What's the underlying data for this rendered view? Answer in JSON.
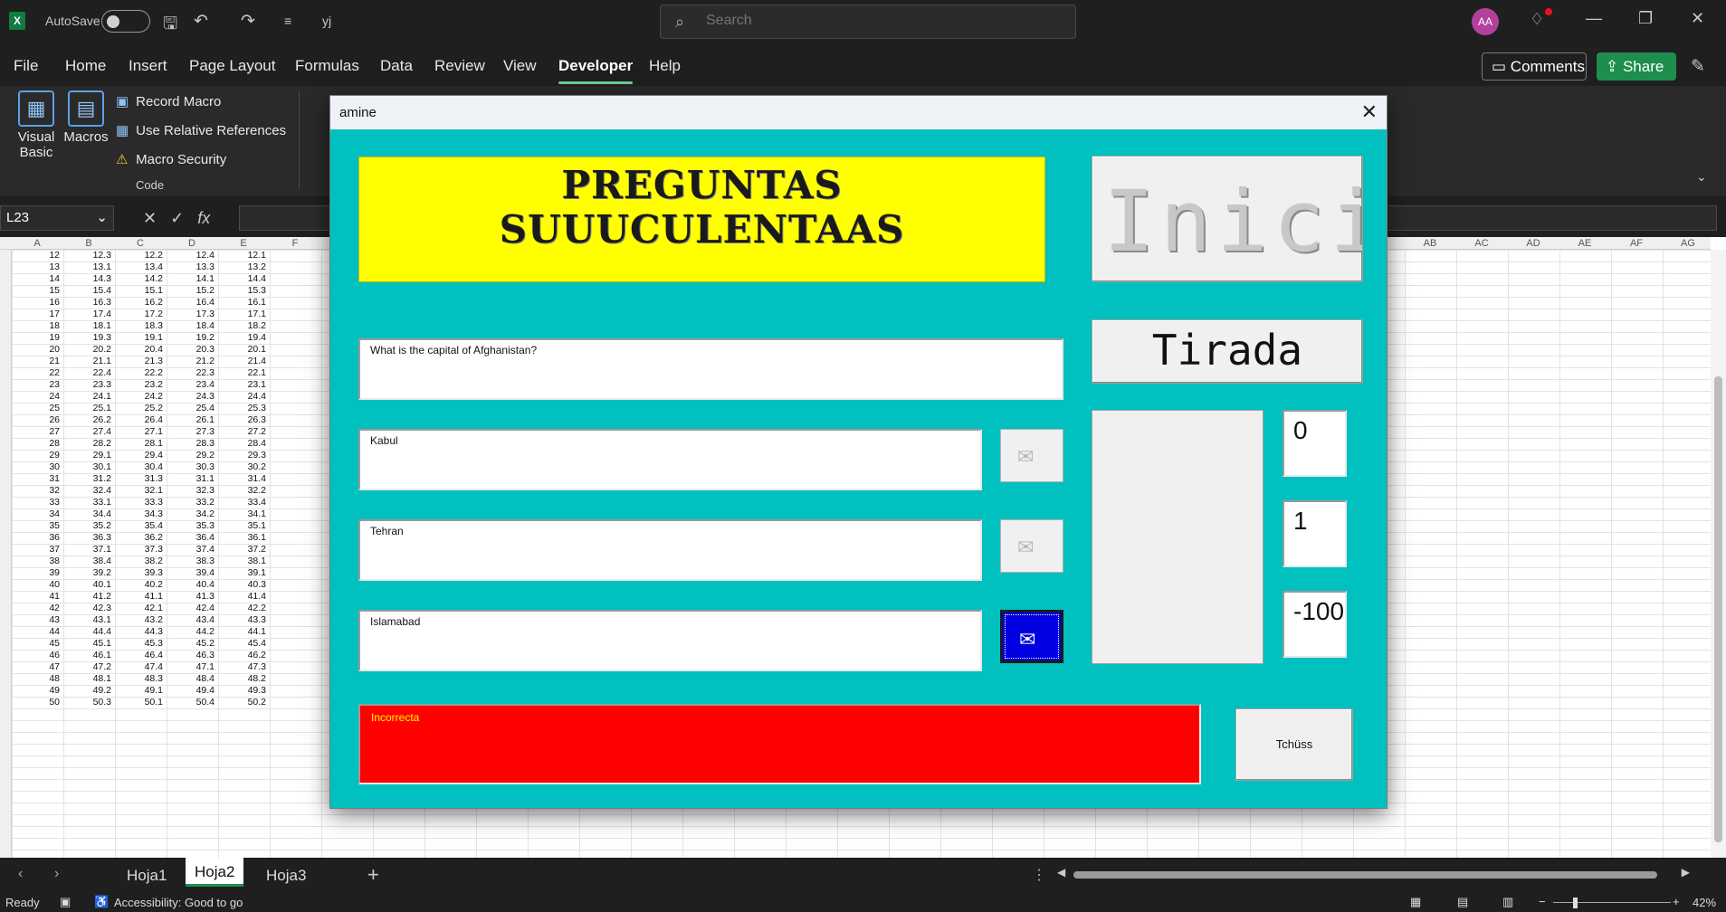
{
  "titlebar": {
    "autosave_label": "AutoSave",
    "filename": "yj",
    "search_placeholder": "Search",
    "avatar_initials": "AA"
  },
  "menu": {
    "tabs": [
      "File",
      "Home",
      "Insert",
      "Page Layout",
      "Formulas",
      "Data",
      "Review",
      "View",
      "Developer",
      "Help"
    ],
    "active": "Developer",
    "comments_label": "Comments",
    "share_label": "Share"
  },
  "ribbon": {
    "visual_basic_label": "Visual Basic",
    "macros_label": "Macros",
    "record_macro_label": "Record Macro",
    "relative_refs_label": "Use Relative References",
    "macro_security_label": "Macro Security",
    "group_label": "Code"
  },
  "formula_bar": {
    "name_box": "L23",
    "fx": "fx",
    "formula": ""
  },
  "grid": {
    "columns_left": [
      "A",
      "B",
      "C",
      "D",
      "E",
      "F"
    ],
    "columns_right": [
      "AB",
      "AC",
      "AD",
      "AE",
      "AF",
      "AG"
    ],
    "rows": [
      [
        "12",
        "12.3",
        "12.2",
        "12.4",
        "12.1"
      ],
      [
        "13",
        "13.1",
        "13.4",
        "13.3",
        "13.2"
      ],
      [
        "14",
        "14.3",
        "14.2",
        "14.1",
        "14.4"
      ],
      [
        "15",
        "15.4",
        "15.1",
        "15.2",
        "15.3"
      ],
      [
        "16",
        "16.3",
        "16.2",
        "16.4",
        "16.1"
      ],
      [
        "17",
        "17.4",
        "17.2",
        "17.3",
        "17.1"
      ],
      [
        "18",
        "18.1",
        "18.3",
        "18.4",
        "18.2"
      ],
      [
        "19",
        "19.3",
        "19.1",
        "19.2",
        "19.4"
      ],
      [
        "20",
        "20.2",
        "20.4",
        "20.3",
        "20.1"
      ],
      [
        "21",
        "21.1",
        "21.3",
        "21.2",
        "21.4"
      ],
      [
        "22",
        "22.4",
        "22.2",
        "22.3",
        "22.1"
      ],
      [
        "23",
        "23.3",
        "23.2",
        "23.4",
        "23.1"
      ],
      [
        "24",
        "24.1",
        "24.2",
        "24.3",
        "24.4"
      ],
      [
        "25",
        "25.1",
        "25.2",
        "25.4",
        "25.3"
      ],
      [
        "26",
        "26.2",
        "26.4",
        "26.1",
        "26.3"
      ],
      [
        "27",
        "27.4",
        "27.1",
        "27.3",
        "27.2"
      ],
      [
        "28",
        "28.2",
        "28.1",
        "28.3",
        "28.4"
      ],
      [
        "29",
        "29.1",
        "29.4",
        "29.2",
        "29.3"
      ],
      [
        "30",
        "30.1",
        "30.4",
        "30.3",
        "30.2"
      ],
      [
        "31",
        "31.2",
        "31.3",
        "31.1",
        "31.4"
      ],
      [
        "32",
        "32.4",
        "32.1",
        "32.3",
        "32.2"
      ],
      [
        "33",
        "33.1",
        "33.3",
        "33.2",
        "33.4"
      ],
      [
        "34",
        "34.4",
        "34.3",
        "34.2",
        "34.1"
      ],
      [
        "35",
        "35.2",
        "35.4",
        "35.3",
        "35.1"
      ],
      [
        "36",
        "36.3",
        "36.2",
        "36.4",
        "36.1"
      ],
      [
        "37",
        "37.1",
        "37.3",
        "37.4",
        "37.2"
      ],
      [
        "38",
        "38.4",
        "38.2",
        "38.3",
        "38.1"
      ],
      [
        "39",
        "39.2",
        "39.3",
        "39.4",
        "39.1"
      ],
      [
        "40",
        "40.1",
        "40.2",
        "40.4",
        "40.3"
      ],
      [
        "41",
        "41.2",
        "41.1",
        "41.3",
        "41.4"
      ],
      [
        "42",
        "42.3",
        "42.1",
        "42.4",
        "42.2"
      ],
      [
        "43",
        "43.1",
        "43.2",
        "43.4",
        "43.3"
      ],
      [
        "44",
        "44.4",
        "44.3",
        "44.2",
        "44.1"
      ],
      [
        "45",
        "45.1",
        "45.3",
        "45.2",
        "45.4"
      ],
      [
        "46",
        "46.1",
        "46.4",
        "46.3",
        "46.2"
      ],
      [
        "47",
        "47.2",
        "47.4",
        "47.1",
        "47.3"
      ],
      [
        "48",
        "48.1",
        "48.3",
        "48.4",
        "48.2"
      ],
      [
        "49",
        "49.2",
        "49.1",
        "49.4",
        "49.3"
      ],
      [
        "50",
        "50.3",
        "50.1",
        "50.4",
        "50.2"
      ]
    ]
  },
  "sheets": {
    "tabs": [
      "Hoja1",
      "Hoja2",
      "Hoja3"
    ],
    "active": "Hoja2"
  },
  "status": {
    "ready": "Ready",
    "accessibility": "Accessibility: Good to go",
    "zoom": "42%"
  },
  "userform": {
    "title": "amine",
    "banner": "PREGUNTAS SUUUCULENTAAS",
    "question": "What is the capital of Afghanistan?",
    "answers": [
      "Kabul",
      "Tehran",
      "Islamabad"
    ],
    "selected_answer_index": 2,
    "result": "Incorrecta",
    "inici_label": "Inici",
    "tirada_label": "Tirada",
    "scores": [
      "0",
      "1",
      "-100"
    ],
    "exit_label": "Tchüss",
    "colors": {
      "form_bg": "#00c0c0",
      "banner_bg": "#ffff00",
      "result_bg": "#ff0000",
      "result_text": "#ffff00",
      "selected_option": "#0000e0"
    }
  }
}
